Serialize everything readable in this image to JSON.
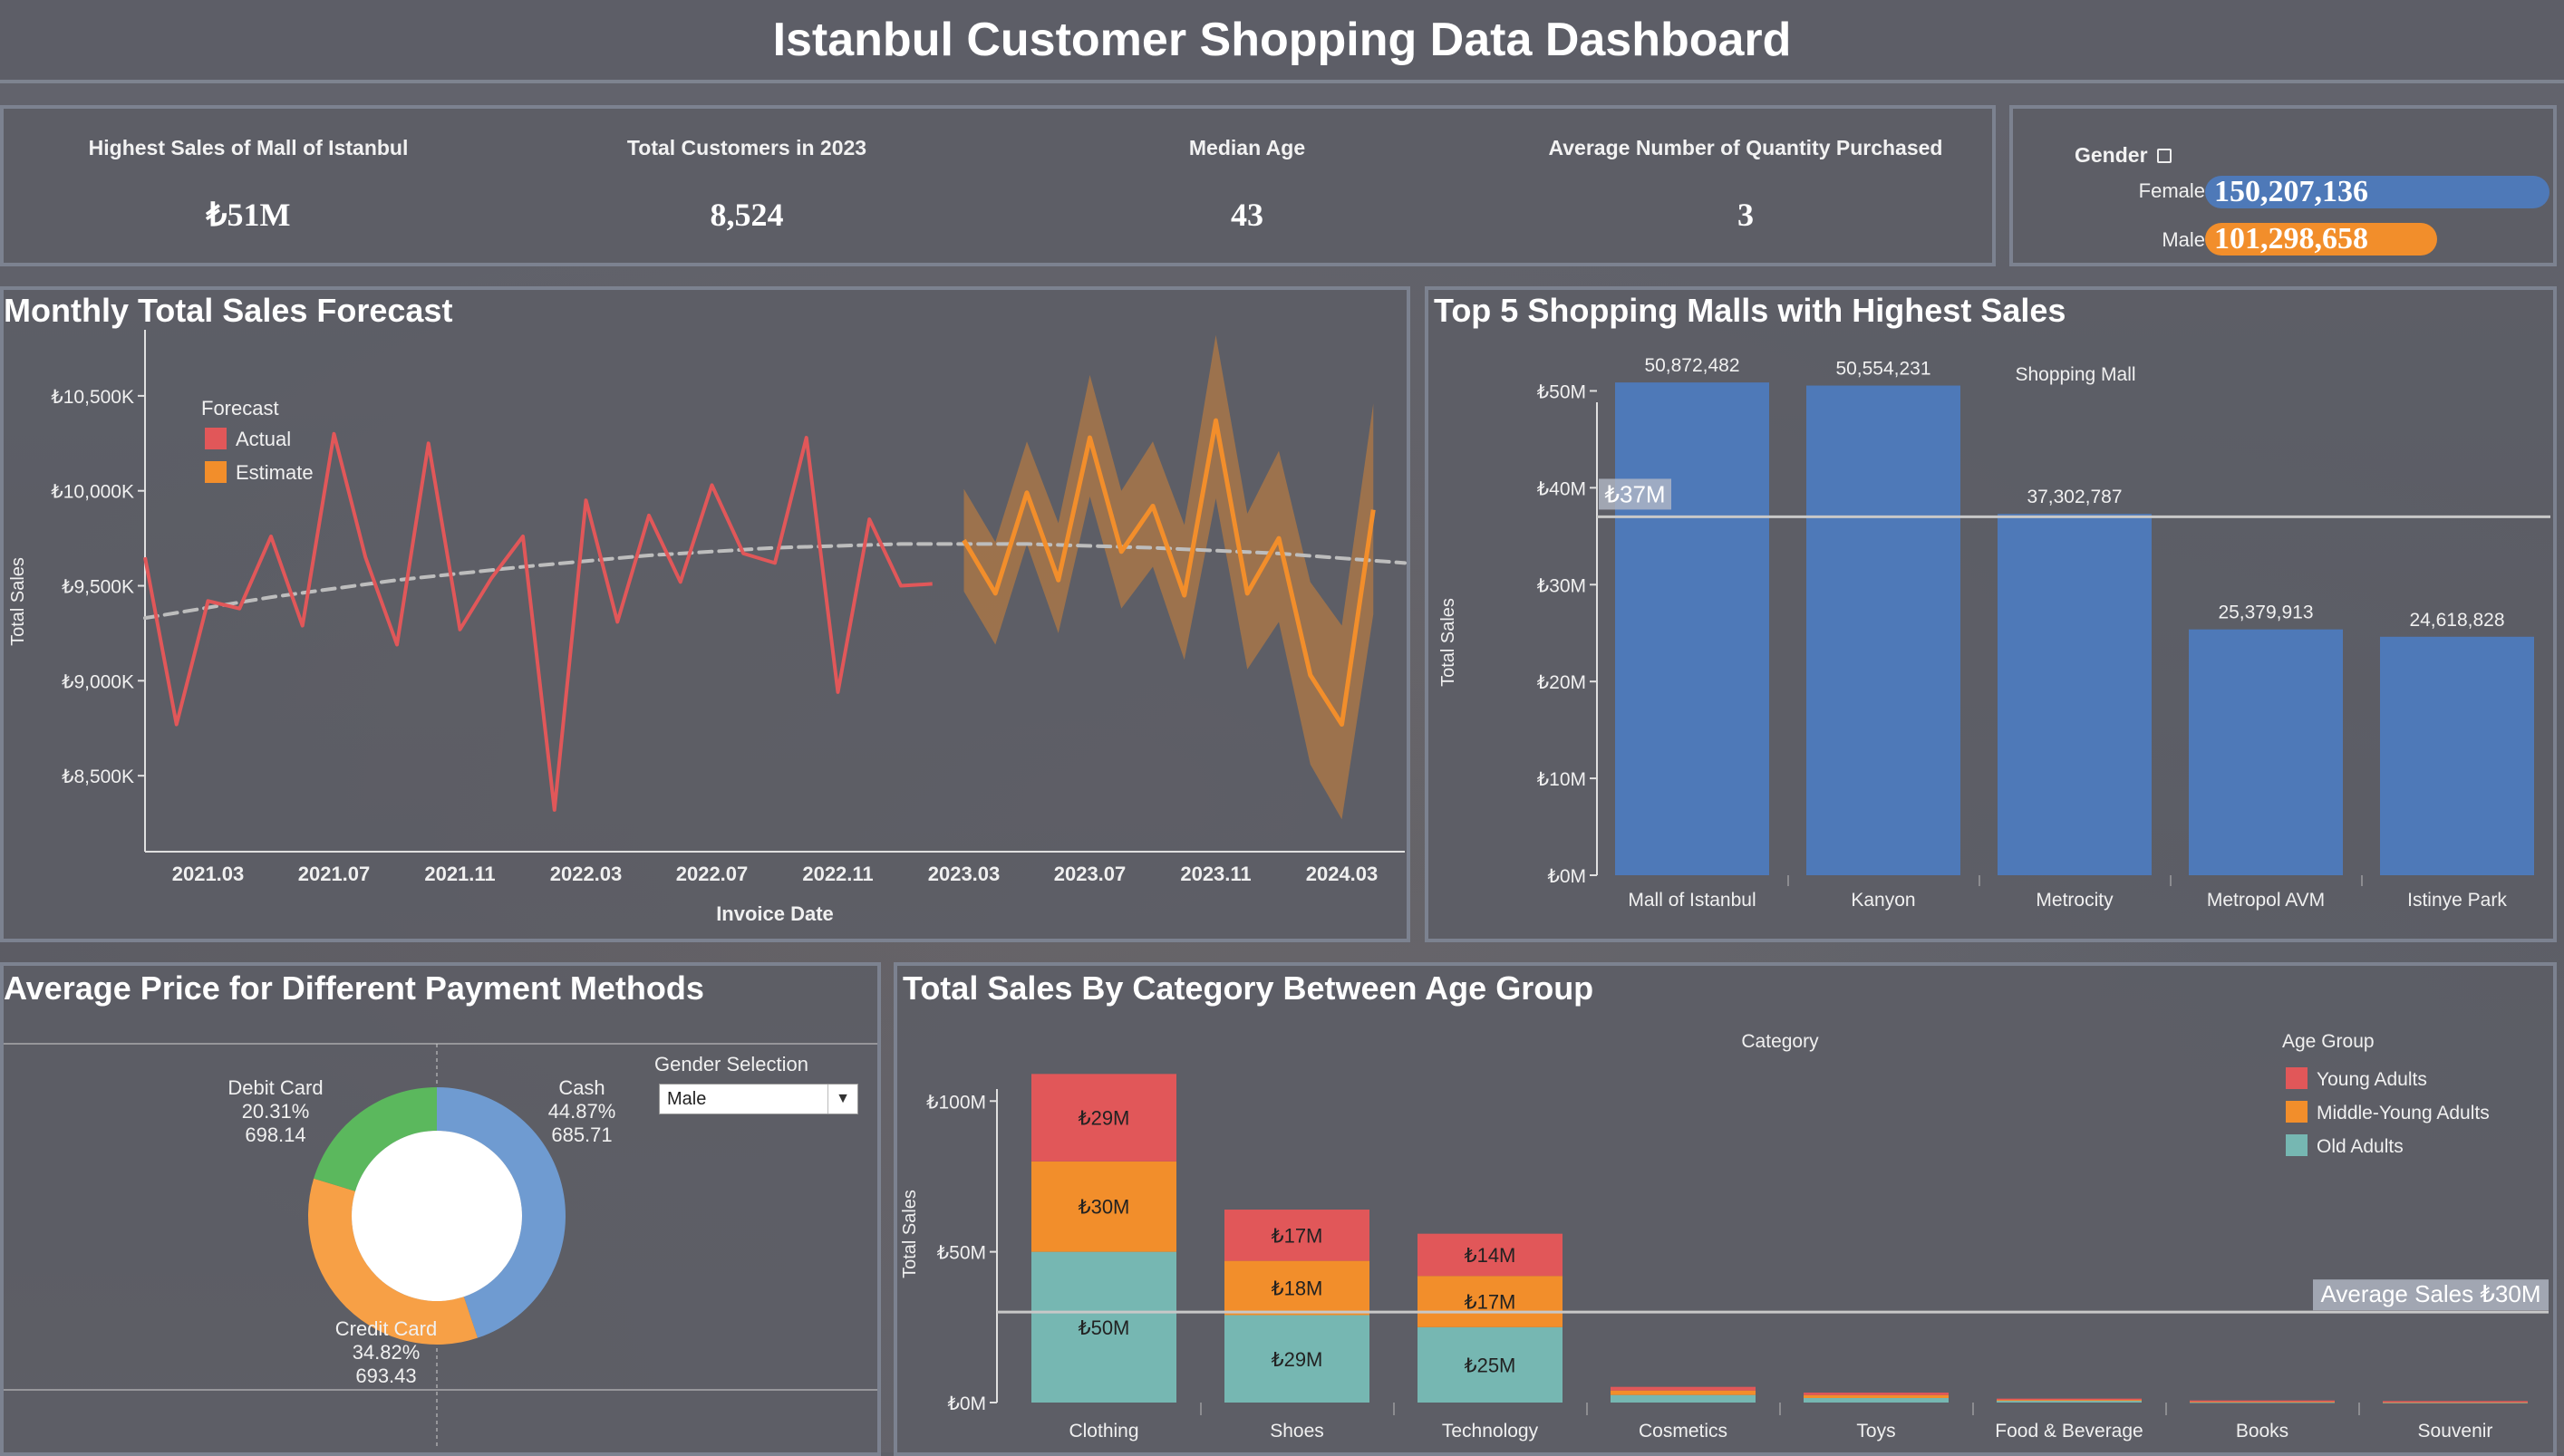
{
  "header": {
    "title": "Istanbul Customer Shopping Data Dashboard"
  },
  "kpis": [
    {
      "label": "Highest Sales of Mall of Istanbul",
      "value": "₺51M"
    },
    {
      "label": "Total Customers in 2023",
      "value": "8,524"
    },
    {
      "label": "Median Age",
      "value": "43"
    },
    {
      "label": "Average Number of Quantity Purchased",
      "value": "3"
    }
  ],
  "gender": {
    "title": "Gender",
    "icon": "lock-icon",
    "rows": [
      {
        "label": "Female",
        "value": "150,207,136",
        "fraction": 1.0,
        "color": "#4e79b8"
      },
      {
        "label": "Male",
        "value": "101,298,658",
        "fraction": 0.674,
        "color": "#f28e2b"
      }
    ]
  },
  "forecast": {
    "title": "Monthly Total Sales Forecast",
    "legend_title": "Forecast",
    "legend": [
      {
        "label": "Actual",
        "color": "#e15759"
      },
      {
        "label": "Estimate",
        "color": "#f28e2b"
      }
    ]
  },
  "malls": {
    "title": "Top 5 Shopping Malls with Highest Sales",
    "ref_label": "₺37M"
  },
  "payment": {
    "title": "Average Price for Different Payment Methods",
    "filter_label": "Gender Selection",
    "filter_value": "Male",
    "labels": [
      {
        "name": "Debit Card",
        "pct": "20.31%",
        "avg": "698.14"
      },
      {
        "name": "Cash",
        "pct": "44.87%",
        "avg": "685.71"
      },
      {
        "name": "Credit Card",
        "pct": "34.82%",
        "avg": "693.43"
      }
    ]
  },
  "category": {
    "title": "Total Sales By Category Between Age Group",
    "avg_label": "Average Sales ₺30M"
  },
  "chart_data": [
    {
      "type": "line",
      "title": "",
      "xlabel": "Invoice Date",
      "ylabel": "Total Sales",
      "x_tick_labels": [
        "2021.03",
        "2021.07",
        "2021.11",
        "2022.03",
        "2022.07",
        "2022.11",
        "2023.03",
        "2023.07",
        "2023.11",
        "2024.03"
      ],
      "y_tick_labels": [
        "₺8,500K",
        "₺9,000K",
        "₺9,500K",
        "₺10,000K",
        "₺10,500K"
      ],
      "ylim": [
        8100,
        10800
      ],
      "legend_title": "Forecast",
      "series": [
        {
          "name": "Actual",
          "color": "#e15759",
          "x": [
            "2021.01",
            "2021.02",
            "2021.03",
            "2021.04",
            "2021.05",
            "2021.06",
            "2021.07",
            "2021.08",
            "2021.09",
            "2021.10",
            "2021.11",
            "2021.12",
            "2022.01",
            "2022.02",
            "2022.03",
            "2022.04",
            "2022.05",
            "2022.06",
            "2022.07",
            "2022.08",
            "2022.09",
            "2022.10",
            "2022.11",
            "2022.12",
            "2023.01",
            "2023.02"
          ],
          "values": [
            9650,
            8770,
            9420,
            9380,
            9760,
            9290,
            10300,
            9650,
            9190,
            10250,
            9270,
            9540,
            9760,
            8320,
            9950,
            9310,
            9870,
            9520,
            10030,
            9670,
            9620,
            10280,
            8940,
            9850,
            9500,
            9510
          ]
        },
        {
          "name": "Estimate",
          "color": "#f28e2b",
          "x": [
            "2023.03",
            "2023.04",
            "2023.05",
            "2023.06",
            "2023.07",
            "2023.08",
            "2023.09",
            "2023.10",
            "2023.11",
            "2023.12",
            "2024.01",
            "2024.02",
            "2024.03",
            "2024.04"
          ],
          "values": [
            9740,
            9460,
            9990,
            9530,
            10280,
            9680,
            9920,
            9450,
            10370,
            9460,
            9750,
            9030,
            8770,
            9900
          ],
          "band_low": [
            9470,
            9190,
            9720,
            9250,
            9970,
            9380,
            9600,
            9110,
            9960,
            9060,
            9310,
            8560,
            8270,
            9350
          ],
          "band_high": [
            10010,
            9730,
            10260,
            9830,
            10610,
            10000,
            10260,
            9820,
            10820,
            9880,
            10210,
            9520,
            9290,
            10460
          ]
        },
        {
          "name": "Trend",
          "color": "#bdbdbd",
          "x_index": [
            0,
            4,
            8,
            12,
            16,
            20,
            24,
            28,
            32,
            36,
            40
          ],
          "values": [
            9330,
            9440,
            9530,
            9600,
            9660,
            9700,
            9720,
            9720,
            9700,
            9670,
            9620
          ]
        }
      ]
    },
    {
      "type": "bar",
      "title": "Shopping Mall",
      "ylabel": "Total Sales",
      "categories": [
        "Mall of Istanbul",
        "Kanyon",
        "Metrocity",
        "Metropol AVM",
        "Istinye Park"
      ],
      "values": [
        50872482,
        50554231,
        37302787,
        25379913,
        24618828
      ],
      "data_labels": [
        "50,872,482",
        "50,554,231",
        "37,302,787",
        "25,379,913",
        "24,618,828"
      ],
      "y_tick_labels": [
        "₺0M",
        "₺10M",
        "₺20M",
        "₺30M",
        "₺40M",
        "₺50M"
      ],
      "ylim": [
        0,
        55000000
      ],
      "reference_line": 37000000,
      "color": "#4e79b8"
    },
    {
      "type": "pie",
      "title": "",
      "slices": [
        {
          "name": "Cash",
          "pct": 44.87,
          "color": "#6f9bd1"
        },
        {
          "name": "Credit Card",
          "pct": 34.82,
          "color": "#f7a046"
        },
        {
          "name": "Debit Card",
          "pct": 20.31,
          "color": "#5bb85d"
        }
      ]
    },
    {
      "type": "bar",
      "title": "Category",
      "ylabel": "Total Sales",
      "legend_title": "Age Group",
      "categories": [
        "Clothing",
        "Shoes",
        "Technology",
        "Cosmetics",
        "Toys",
        "Food & Beverage",
        "Books",
        "Souvenir"
      ],
      "y_tick_labels": [
        "₺0M",
        "₺50M",
        "₺100M"
      ],
      "ylim": [
        0,
        110
      ],
      "reference_line": 30,
      "series": [
        {
          "name": "Old Adults",
          "color": "#76b7b2",
          "values": [
            50,
            29,
            25,
            2.5,
            1.5,
            0.6,
            0.3,
            0.2
          ],
          "labels": [
            "₺50M",
            "₺29M",
            "₺25M",
            "",
            "",
            "",
            "",
            ""
          ]
        },
        {
          "name": "Middle-Young Adults",
          "color": "#f28e2b",
          "values": [
            30,
            18,
            17,
            1.5,
            1.0,
            0.4,
            0.2,
            0.15
          ],
          "labels": [
            "₺30M",
            "₺18M",
            "₺17M",
            "",
            "",
            "",
            "",
            ""
          ]
        },
        {
          "name": "Young Adults",
          "color": "#e15759",
          "values": [
            29,
            17,
            14,
            1.2,
            0.8,
            0.3,
            0.2,
            0.15
          ],
          "labels": [
            "₺29M",
            "₺17M",
            "₺14M",
            "",
            "",
            "",
            "",
            ""
          ]
        }
      ]
    }
  ]
}
